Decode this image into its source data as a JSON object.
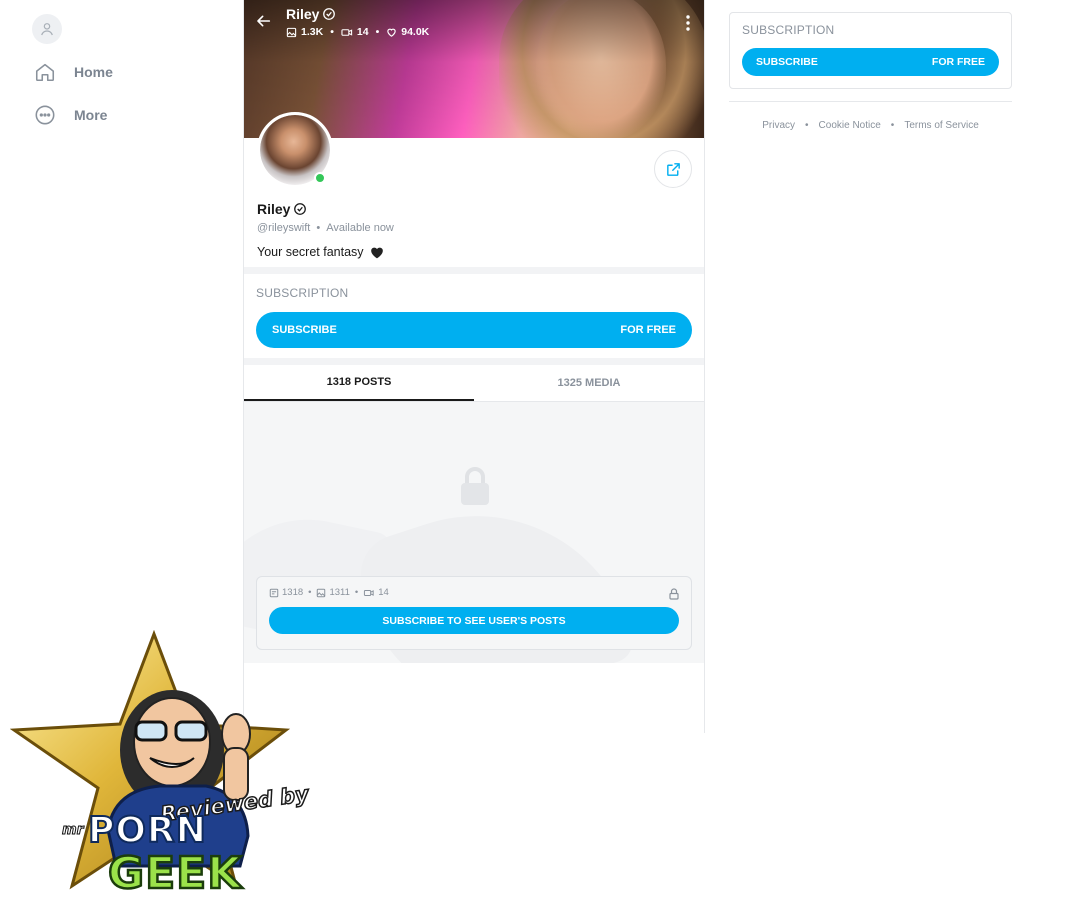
{
  "nav": {
    "items": [
      {
        "label": "Home",
        "icon": "home-icon"
      },
      {
        "label": "More",
        "icon": "more-circle-icon"
      }
    ]
  },
  "profile": {
    "name": "Riley",
    "stats": {
      "photos": "1.3K",
      "videos": "14",
      "likes": "94.0K"
    },
    "handle": "@rileyswift",
    "status": "Available now",
    "bio": "Your secret fantasy",
    "bio_emoji": "black-heart"
  },
  "subscription": {
    "title": "SUBSCRIPTION",
    "button_left": "SUBSCRIBE",
    "button_right": "FOR FREE"
  },
  "tabs": [
    {
      "label": "1318 POSTS",
      "active": true
    },
    {
      "label": "1325 MEDIA",
      "active": false
    }
  ],
  "locked": {
    "posts": "1318",
    "photos": "1311",
    "videos": "14",
    "button": "SUBSCRIBE TO SEE USER'S POSTS"
  },
  "sidebar": {
    "title": "SUBSCRIPTION",
    "button_left": "SUBSCRIBE",
    "button_right": "FOR FREE"
  },
  "footer": {
    "links": [
      "Privacy",
      "Cookie Notice",
      "Terms of Service"
    ]
  },
  "watermark": {
    "line1": "Reviewed by",
    "mr": "mr",
    "word1": "PORN",
    "word2": "GEEK"
  },
  "colors": {
    "accent": "#00aff0",
    "online": "#34c759",
    "muted": "#8a929c"
  }
}
